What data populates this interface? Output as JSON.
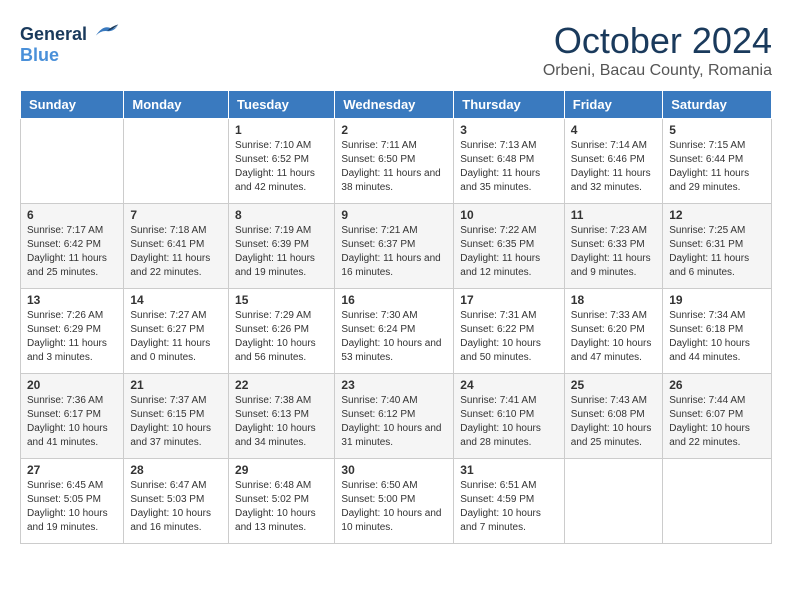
{
  "logo": {
    "general": "General",
    "blue": "Blue"
  },
  "title": "October 2024",
  "subtitle": "Orbeni, Bacau County, Romania",
  "header_days": [
    "Sunday",
    "Monday",
    "Tuesday",
    "Wednesday",
    "Thursday",
    "Friday",
    "Saturday"
  ],
  "weeks": [
    [
      {
        "day": "",
        "info": ""
      },
      {
        "day": "",
        "info": ""
      },
      {
        "day": "1",
        "info": "Sunrise: 7:10 AM\nSunset: 6:52 PM\nDaylight: 11 hours and 42 minutes."
      },
      {
        "day": "2",
        "info": "Sunrise: 7:11 AM\nSunset: 6:50 PM\nDaylight: 11 hours and 38 minutes."
      },
      {
        "day": "3",
        "info": "Sunrise: 7:13 AM\nSunset: 6:48 PM\nDaylight: 11 hours and 35 minutes."
      },
      {
        "day": "4",
        "info": "Sunrise: 7:14 AM\nSunset: 6:46 PM\nDaylight: 11 hours and 32 minutes."
      },
      {
        "day": "5",
        "info": "Sunrise: 7:15 AM\nSunset: 6:44 PM\nDaylight: 11 hours and 29 minutes."
      }
    ],
    [
      {
        "day": "6",
        "info": "Sunrise: 7:17 AM\nSunset: 6:42 PM\nDaylight: 11 hours and 25 minutes."
      },
      {
        "day": "7",
        "info": "Sunrise: 7:18 AM\nSunset: 6:41 PM\nDaylight: 11 hours and 22 minutes."
      },
      {
        "day": "8",
        "info": "Sunrise: 7:19 AM\nSunset: 6:39 PM\nDaylight: 11 hours and 19 minutes."
      },
      {
        "day": "9",
        "info": "Sunrise: 7:21 AM\nSunset: 6:37 PM\nDaylight: 11 hours and 16 minutes."
      },
      {
        "day": "10",
        "info": "Sunrise: 7:22 AM\nSunset: 6:35 PM\nDaylight: 11 hours and 12 minutes."
      },
      {
        "day": "11",
        "info": "Sunrise: 7:23 AM\nSunset: 6:33 PM\nDaylight: 11 hours and 9 minutes."
      },
      {
        "day": "12",
        "info": "Sunrise: 7:25 AM\nSunset: 6:31 PM\nDaylight: 11 hours and 6 minutes."
      }
    ],
    [
      {
        "day": "13",
        "info": "Sunrise: 7:26 AM\nSunset: 6:29 PM\nDaylight: 11 hours and 3 minutes."
      },
      {
        "day": "14",
        "info": "Sunrise: 7:27 AM\nSunset: 6:27 PM\nDaylight: 11 hours and 0 minutes."
      },
      {
        "day": "15",
        "info": "Sunrise: 7:29 AM\nSunset: 6:26 PM\nDaylight: 10 hours and 56 minutes."
      },
      {
        "day": "16",
        "info": "Sunrise: 7:30 AM\nSunset: 6:24 PM\nDaylight: 10 hours and 53 minutes."
      },
      {
        "day": "17",
        "info": "Sunrise: 7:31 AM\nSunset: 6:22 PM\nDaylight: 10 hours and 50 minutes."
      },
      {
        "day": "18",
        "info": "Sunrise: 7:33 AM\nSunset: 6:20 PM\nDaylight: 10 hours and 47 minutes."
      },
      {
        "day": "19",
        "info": "Sunrise: 7:34 AM\nSunset: 6:18 PM\nDaylight: 10 hours and 44 minutes."
      }
    ],
    [
      {
        "day": "20",
        "info": "Sunrise: 7:36 AM\nSunset: 6:17 PM\nDaylight: 10 hours and 41 minutes."
      },
      {
        "day": "21",
        "info": "Sunrise: 7:37 AM\nSunset: 6:15 PM\nDaylight: 10 hours and 37 minutes."
      },
      {
        "day": "22",
        "info": "Sunrise: 7:38 AM\nSunset: 6:13 PM\nDaylight: 10 hours and 34 minutes."
      },
      {
        "day": "23",
        "info": "Sunrise: 7:40 AM\nSunset: 6:12 PM\nDaylight: 10 hours and 31 minutes."
      },
      {
        "day": "24",
        "info": "Sunrise: 7:41 AM\nSunset: 6:10 PM\nDaylight: 10 hours and 28 minutes."
      },
      {
        "day": "25",
        "info": "Sunrise: 7:43 AM\nSunset: 6:08 PM\nDaylight: 10 hours and 25 minutes."
      },
      {
        "day": "26",
        "info": "Sunrise: 7:44 AM\nSunset: 6:07 PM\nDaylight: 10 hours and 22 minutes."
      }
    ],
    [
      {
        "day": "27",
        "info": "Sunrise: 6:45 AM\nSunset: 5:05 PM\nDaylight: 10 hours and 19 minutes."
      },
      {
        "day": "28",
        "info": "Sunrise: 6:47 AM\nSunset: 5:03 PM\nDaylight: 10 hours and 16 minutes."
      },
      {
        "day": "29",
        "info": "Sunrise: 6:48 AM\nSunset: 5:02 PM\nDaylight: 10 hours and 13 minutes."
      },
      {
        "day": "30",
        "info": "Sunrise: 6:50 AM\nSunset: 5:00 PM\nDaylight: 10 hours and 10 minutes."
      },
      {
        "day": "31",
        "info": "Sunrise: 6:51 AM\nSunset: 4:59 PM\nDaylight: 10 hours and 7 minutes."
      },
      {
        "day": "",
        "info": ""
      },
      {
        "day": "",
        "info": ""
      }
    ]
  ]
}
